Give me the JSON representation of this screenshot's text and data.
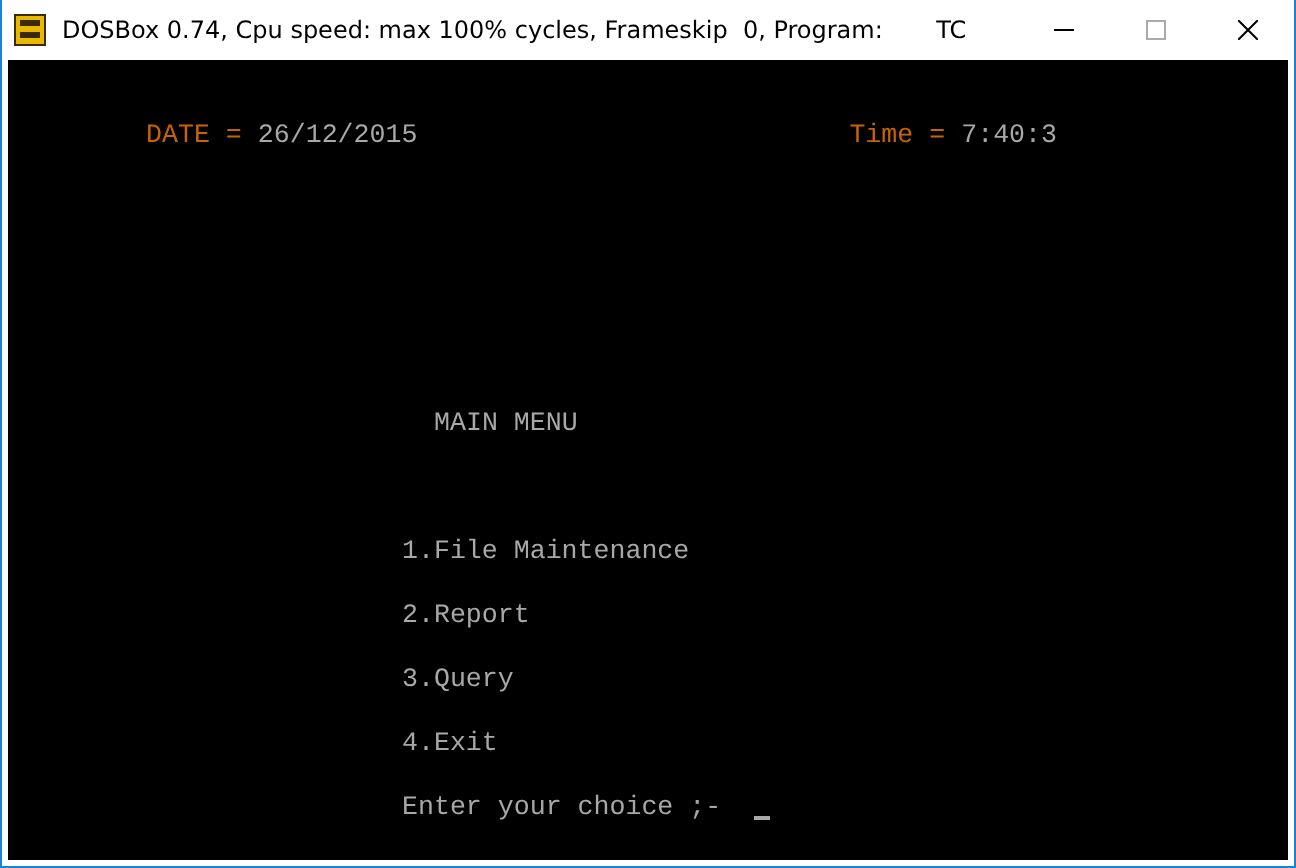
{
  "window": {
    "title": "DOSBox 0.74, Cpu speed: max 100% cycles, Frameskip  0, Program:       TC"
  },
  "header": {
    "date_label": "DATE",
    "date_sep": "=",
    "date": "26/12/2015",
    "time_label": "Time",
    "time_sep": "=",
    "time": "7:40:3"
  },
  "menu": {
    "title": "MAIN MENU",
    "items": [
      "1.File Maintenance",
      "2.Report",
      "3.Query",
      "4.Exit"
    ]
  },
  "prompt": {
    "label": "Enter your choice ;-"
  }
}
